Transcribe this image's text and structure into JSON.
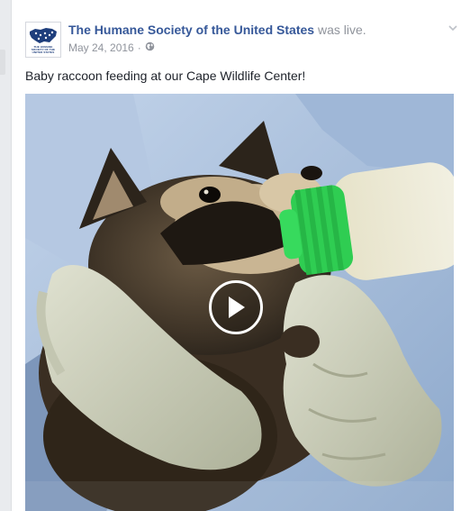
{
  "post": {
    "page_name": "The Humane Society of the United States",
    "action": "was live.",
    "date": "May 24, 2016",
    "separator": "·",
    "text": "Baby raccoon feeding at our Cape Wildlife Center!",
    "avatar_caption": "THE HUMANE SOCIETY OF THE UNITED STATES"
  },
  "icons": {
    "audience": "globe-icon",
    "options": "chevron-down-icon",
    "video": "play-icon"
  },
  "colors": {
    "link": "#365899",
    "meta": "#90949c",
    "text": "#1d2129",
    "bottle_cap": "#34d65a",
    "glove": "#c9cdb5",
    "gown": "#a9c1df"
  }
}
